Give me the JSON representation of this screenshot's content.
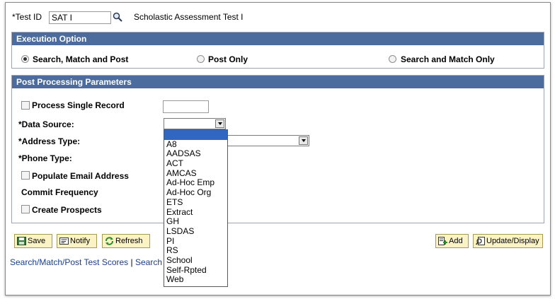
{
  "test": {
    "label": "*Test ID",
    "value": "SAT I",
    "description": "Scholastic Assessment Test I"
  },
  "execution": {
    "header": "Execution Option",
    "options": [
      {
        "label": "Search, Match and Post",
        "selected": true
      },
      {
        "label": "Post Only",
        "selected": false
      },
      {
        "label": "Search and Match Only",
        "selected": false
      }
    ]
  },
  "params": {
    "header": "Post Processing Parameters",
    "process_single_record": "Process Single Record",
    "data_source": "*Data Source:",
    "address_type": "*Address Type:",
    "phone_type": "*Phone Type:",
    "populate_email": "Populate Email Address",
    "commit_frequency": "Commit Frequency",
    "create_prospects": "Create Prospects"
  },
  "dropdown": {
    "options": [
      "",
      "A8",
      "AADSAS",
      "ACT",
      "AMCAS",
      "Ad-Hoc Emp",
      "Ad-Hoc Org",
      "ETS",
      "Extract",
      "GH",
      "LSDAS",
      "PI",
      "RS",
      "School",
      "Self-Rpted",
      "Web"
    ]
  },
  "buttons": {
    "save": "Save",
    "notify": "Notify",
    "refresh": "Refresh",
    "add": "Add",
    "update_display": "Update/Display"
  },
  "links": {
    "search_match_post": "Search/Match/Post Test Scores",
    "separator": "|",
    "search": "Search"
  },
  "colors": {
    "header_bg": "#4d6c9e",
    "button_bg": "#fcf3c4",
    "dropdown_selected": "#3166c3"
  }
}
